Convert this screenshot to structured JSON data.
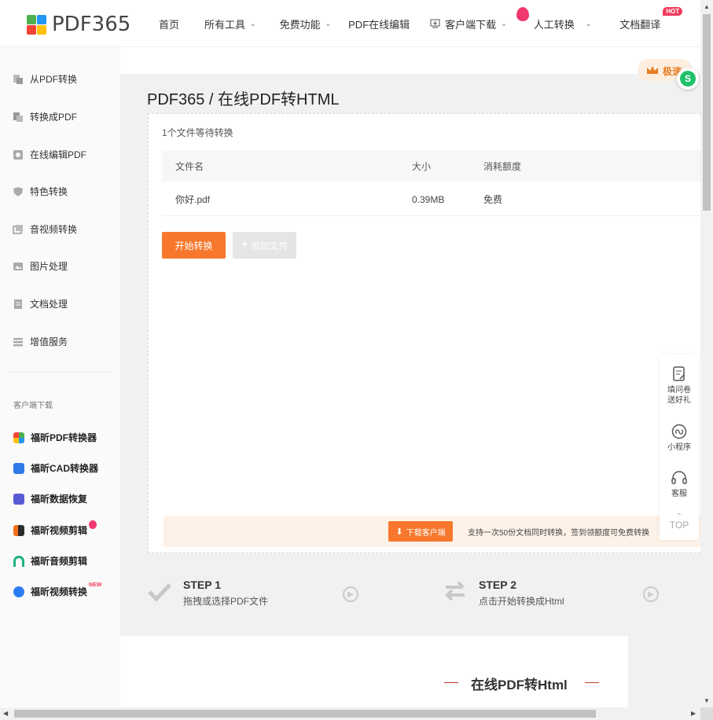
{
  "header": {
    "logo_text": "PDF365",
    "nav": [
      {
        "label": "首页",
        "has_chevron": false
      },
      {
        "label": "所有工具",
        "has_chevron": true
      },
      {
        "label": "免费功能",
        "has_chevron": true
      },
      {
        "label": "PDF在线编辑",
        "has_chevron": false
      },
      {
        "label": "客户端下载",
        "has_chevron": true
      },
      {
        "label": "人工转换",
        "has_chevron": true
      },
      {
        "label": "文档翻译",
        "has_chevron": false,
        "badge": "HOT"
      }
    ]
  },
  "sidebar": {
    "items": [
      {
        "label": "从PDF转换",
        "icon": "pdf-from-icon"
      },
      {
        "label": "转换成PDF",
        "icon": "pdf-to-icon"
      },
      {
        "label": "在线编辑PDF",
        "icon": "edit-icon"
      },
      {
        "label": "特色转换",
        "icon": "shield-icon"
      },
      {
        "label": "音视频转换",
        "icon": "media-icon"
      },
      {
        "label": "图片处理",
        "icon": "image-icon"
      },
      {
        "label": "文档处理",
        "icon": "document-icon"
      },
      {
        "label": "增值服务",
        "icon": "list-icon"
      }
    ],
    "download_heading": "客户端下载",
    "apps": [
      {
        "label": "福昕PDF转换器",
        "color": "#4a8cf7"
      },
      {
        "label": "福昕CAD转换器",
        "color": "#2f7bea"
      },
      {
        "label": "福昕数据恢复",
        "color": "#5a5ad6"
      },
      {
        "label": "福昕视频剪辑",
        "color": "#f2701a",
        "badge": "fire"
      },
      {
        "label": "福昕音频剪辑",
        "color": "#1fb37a"
      },
      {
        "label": "福昕视频转换",
        "color": "#2d7cf6",
        "badge": "NEW"
      }
    ]
  },
  "main": {
    "vip_label": "极速",
    "page_title": "PDF365 / 在线PDF转HTML",
    "wait_text": "1个文件等待转换",
    "table": {
      "headers": [
        "文件名",
        "大小",
        "消耗额度"
      ],
      "rows": [
        {
          "name": "你好.pdf",
          "size": "0.39MB",
          "cost": "免费"
        }
      ]
    },
    "start_button": "开始转换",
    "add_button": "添加文件",
    "download_client_button": "下载客户端",
    "promo_text": "支持一次50份文档同时转换，签到领额度可免费转换",
    "steps": [
      {
        "title": "STEP 1",
        "desc": "拖拽或选择PDF文件"
      },
      {
        "title": "STEP 2",
        "desc": "点击开始转换成Html"
      }
    ],
    "intro_title": "在线PDF转Html"
  },
  "float_bar": {
    "survey_line1": "填问卷",
    "survey_line2": "送好礼",
    "mini_program": "小程序",
    "service": "客服",
    "top": "TOP"
  },
  "colors": {
    "accent": "#f7782c",
    "hot_badge": "#f03b5a",
    "promo_bg": "#fef2e8"
  }
}
